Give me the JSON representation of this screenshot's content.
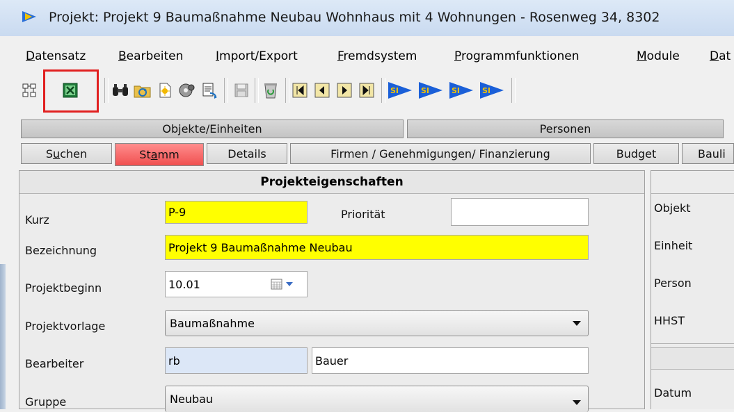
{
  "window": {
    "title": "Projekt: Projekt 9 Baumaßnahme Neubau Wohnhaus mit 4 Wohnungen - Rosenweg 34, 8302"
  },
  "menu": {
    "items": [
      {
        "accel": "D",
        "rest": "atensatz"
      },
      {
        "accel": "B",
        "rest": "earbeiten"
      },
      {
        "accel": "I",
        "rest": "mport/Export"
      },
      {
        "accel": "F",
        "rest": "remdsystem"
      },
      {
        "accel": "P",
        "rest": "rogrammfunktionen"
      },
      {
        "accel": "M",
        "rest": "odule"
      },
      {
        "accel": "D",
        "rest": "at"
      }
    ]
  },
  "toolbar": {
    "icons": [
      "hierarchy-icon",
      "excel-export-icon",
      "binoculars-icon",
      "folder-refresh-icon",
      "new-document-icon",
      "cd-gear-icon",
      "document-transfer-icon",
      "save-icon",
      "recycle-bin-icon",
      "first-record-icon",
      "previous-record-icon",
      "next-record-icon",
      "last-record-icon",
      "si-play-1-icon",
      "si-play-2-icon",
      "si-play-3-icon",
      "si-play-4-icon"
    ],
    "si_label": "SI",
    "nav_glyphs": [
      "⏮",
      "◀",
      "▶",
      "⏭"
    ],
    "highlighted": "excel-export-icon"
  },
  "tabs_top": [
    "Objekte/Einheiten",
    "Personen"
  ],
  "tabs_sub": [
    {
      "pre": "S",
      "acc": "u",
      "post": "chen"
    },
    {
      "pre": "St",
      "acc": "a",
      "post": "mm"
    },
    {
      "pre": "",
      "acc": "",
      "post": "Details"
    },
    {
      "pre": "",
      "acc": "",
      "post": "Firmen / Genehmigungen/ Finanzierung"
    },
    {
      "pre": "",
      "acc": "",
      "post": "Budget"
    },
    {
      "pre": "",
      "acc": "",
      "post": "Bauli"
    }
  ],
  "form": {
    "header": "Projekteigenschaften",
    "kurz_label": "Kurz",
    "kurz_value": "P-9",
    "prioritaet_label": "Priorität",
    "prioritaet_value": "",
    "bezeichnung_label": "Bezeichnung",
    "bezeichnung_value": "Projekt 9 Baumaßnahme Neubau",
    "projektbeginn_label": "Projektbeginn",
    "projektbeginn_value": "10.01",
    "projektvorlage_label": "Projektvorlage",
    "projektvorlage_value": "Baumaßnahme",
    "bearbeiter_label": "Bearbeiter",
    "bearbeiter_code": "rb",
    "bearbeiter_name": "Bauer",
    "gruppe_label": "Gruppe",
    "gruppe_value": "Neubau"
  },
  "right": {
    "objekt": "Objekt",
    "einheit": "Einheit",
    "person": "Person",
    "hhst": "HHST",
    "datum": "Datum"
  },
  "colors": {
    "highlight_border": "#e12020",
    "active_tab": "#f05050",
    "required_field": "#ffff00",
    "readonly_field": "#dce7f7"
  }
}
